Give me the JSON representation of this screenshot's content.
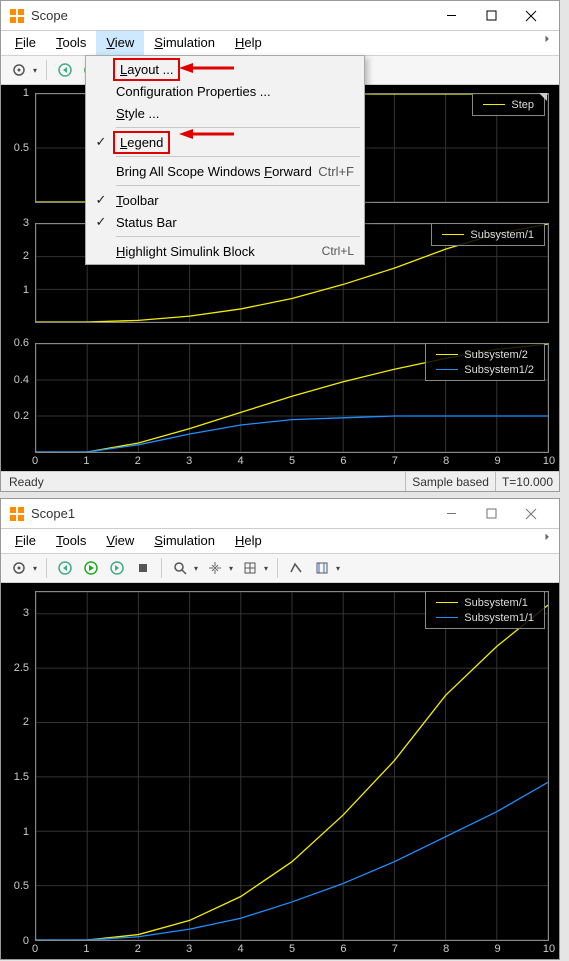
{
  "global": {
    "accent": "#e00000",
    "grid_color": "#333333",
    "line_yellow": "#f4ec00",
    "line_blue": "#1f8fff"
  },
  "window1": {
    "title": "Scope",
    "menu": {
      "file": "File",
      "tools": "Tools",
      "view": "View",
      "simulation": "Simulation",
      "help": "Help"
    },
    "statusbar": {
      "ready": "Ready",
      "mode": "Sample based",
      "time": "T=10.000"
    },
    "dropdown": {
      "layout": "Layout ...",
      "config": "Configuration Properties ...",
      "style": "Style ...",
      "legend": "Legend",
      "bringfwd": "Bring All Scope Windows Forward",
      "bringfwd_accel": "Ctrl+F",
      "toolbar": "Toolbar",
      "statusbar": "Status Bar",
      "highlight": "Highlight Simulink Block",
      "highlight_accel": "Ctrl+L"
    }
  },
  "window2": {
    "title": "Scope1",
    "menu": {
      "file": "File",
      "tools": "Tools",
      "view": "View",
      "simulation": "Simulation",
      "help": "Help"
    }
  },
  "chart_data": [
    {
      "type": "line",
      "window": 1,
      "subplot": 1,
      "title": "",
      "xlim": [
        0,
        10
      ],
      "ylim": [
        0,
        1
      ],
      "yticks": [
        0.5,
        1
      ],
      "xticks": [],
      "legend": [
        {
          "name": "Step",
          "color": "#f4ec00"
        }
      ],
      "series": [
        {
          "name": "Step",
          "color": "#f4ec00",
          "x": [
            0,
            1,
            1,
            10
          ],
          "y": [
            0,
            0,
            1,
            1
          ]
        }
      ]
    },
    {
      "type": "line",
      "window": 1,
      "subplot": 2,
      "xlim": [
        0,
        10
      ],
      "ylim": [
        0,
        3
      ],
      "yticks": [
        1,
        2,
        3
      ],
      "xticks": [],
      "legend": [
        {
          "name": "Subsystem/1",
          "color": "#f4ec00"
        }
      ],
      "series": [
        {
          "name": "Subsystem/1",
          "color": "#f4ec00",
          "x": [
            0,
            1,
            2,
            3,
            4,
            5,
            6,
            7,
            8,
            9,
            10
          ],
          "y": [
            0,
            0,
            0.05,
            0.18,
            0.4,
            0.72,
            1.15,
            1.65,
            2.23,
            2.7,
            3.0
          ]
        }
      ]
    },
    {
      "type": "line",
      "window": 1,
      "subplot": 3,
      "xlim": [
        0,
        10
      ],
      "ylim": [
        0,
        0.6
      ],
      "yticks": [
        0.2,
        0.4,
        0.6
      ],
      "xticks": [
        0,
        1,
        2,
        3,
        4,
        5,
        6,
        7,
        8,
        9,
        10
      ],
      "legend": [
        {
          "name": "Subsystem/2",
          "color": "#f4ec00"
        },
        {
          "name": "Subsystem1/2",
          "color": "#1f8fff"
        }
      ],
      "series": [
        {
          "name": "Subsystem/2",
          "color": "#f4ec00",
          "x": [
            0,
            1,
            2,
            3,
            4,
            5,
            6,
            7,
            8,
            9,
            10
          ],
          "y": [
            0,
            0,
            0.05,
            0.13,
            0.22,
            0.31,
            0.39,
            0.46,
            0.52,
            0.57,
            0.6
          ]
        },
        {
          "name": "Subsystem1/2",
          "color": "#1f8fff",
          "x": [
            0,
            1,
            2,
            3,
            4,
            5,
            6,
            7,
            8,
            9,
            10
          ],
          "y": [
            0,
            0,
            0.04,
            0.1,
            0.15,
            0.18,
            0.19,
            0.2,
            0.2,
            0.2,
            0.2
          ]
        }
      ]
    },
    {
      "type": "line",
      "window": 2,
      "subplot": 1,
      "xlim": [
        0,
        10
      ],
      "ylim": [
        0,
        3.2
      ],
      "yticks": [
        0,
        0.5,
        1,
        1.5,
        2,
        2.5,
        3
      ],
      "xticks": [
        0,
        1,
        2,
        3,
        4,
        5,
        6,
        7,
        8,
        9,
        10
      ],
      "legend": [
        {
          "name": "Subsystem/1",
          "color": "#f4ec00"
        },
        {
          "name": "Subsystem1/1",
          "color": "#1f8fff"
        }
      ],
      "series": [
        {
          "name": "Subsystem/1",
          "color": "#f4ec00",
          "x": [
            0,
            1,
            2,
            3,
            4,
            5,
            6,
            7,
            8,
            9,
            10
          ],
          "y": [
            0,
            0,
            0.05,
            0.18,
            0.4,
            0.72,
            1.15,
            1.65,
            2.25,
            2.7,
            3.08
          ]
        },
        {
          "name": "Subsystem1/1",
          "color": "#1f8fff",
          "x": [
            0,
            1,
            2,
            3,
            4,
            5,
            6,
            7,
            8,
            9,
            10
          ],
          "y": [
            0,
            0,
            0.03,
            0.1,
            0.2,
            0.35,
            0.52,
            0.72,
            0.95,
            1.18,
            1.45
          ]
        }
      ]
    }
  ]
}
